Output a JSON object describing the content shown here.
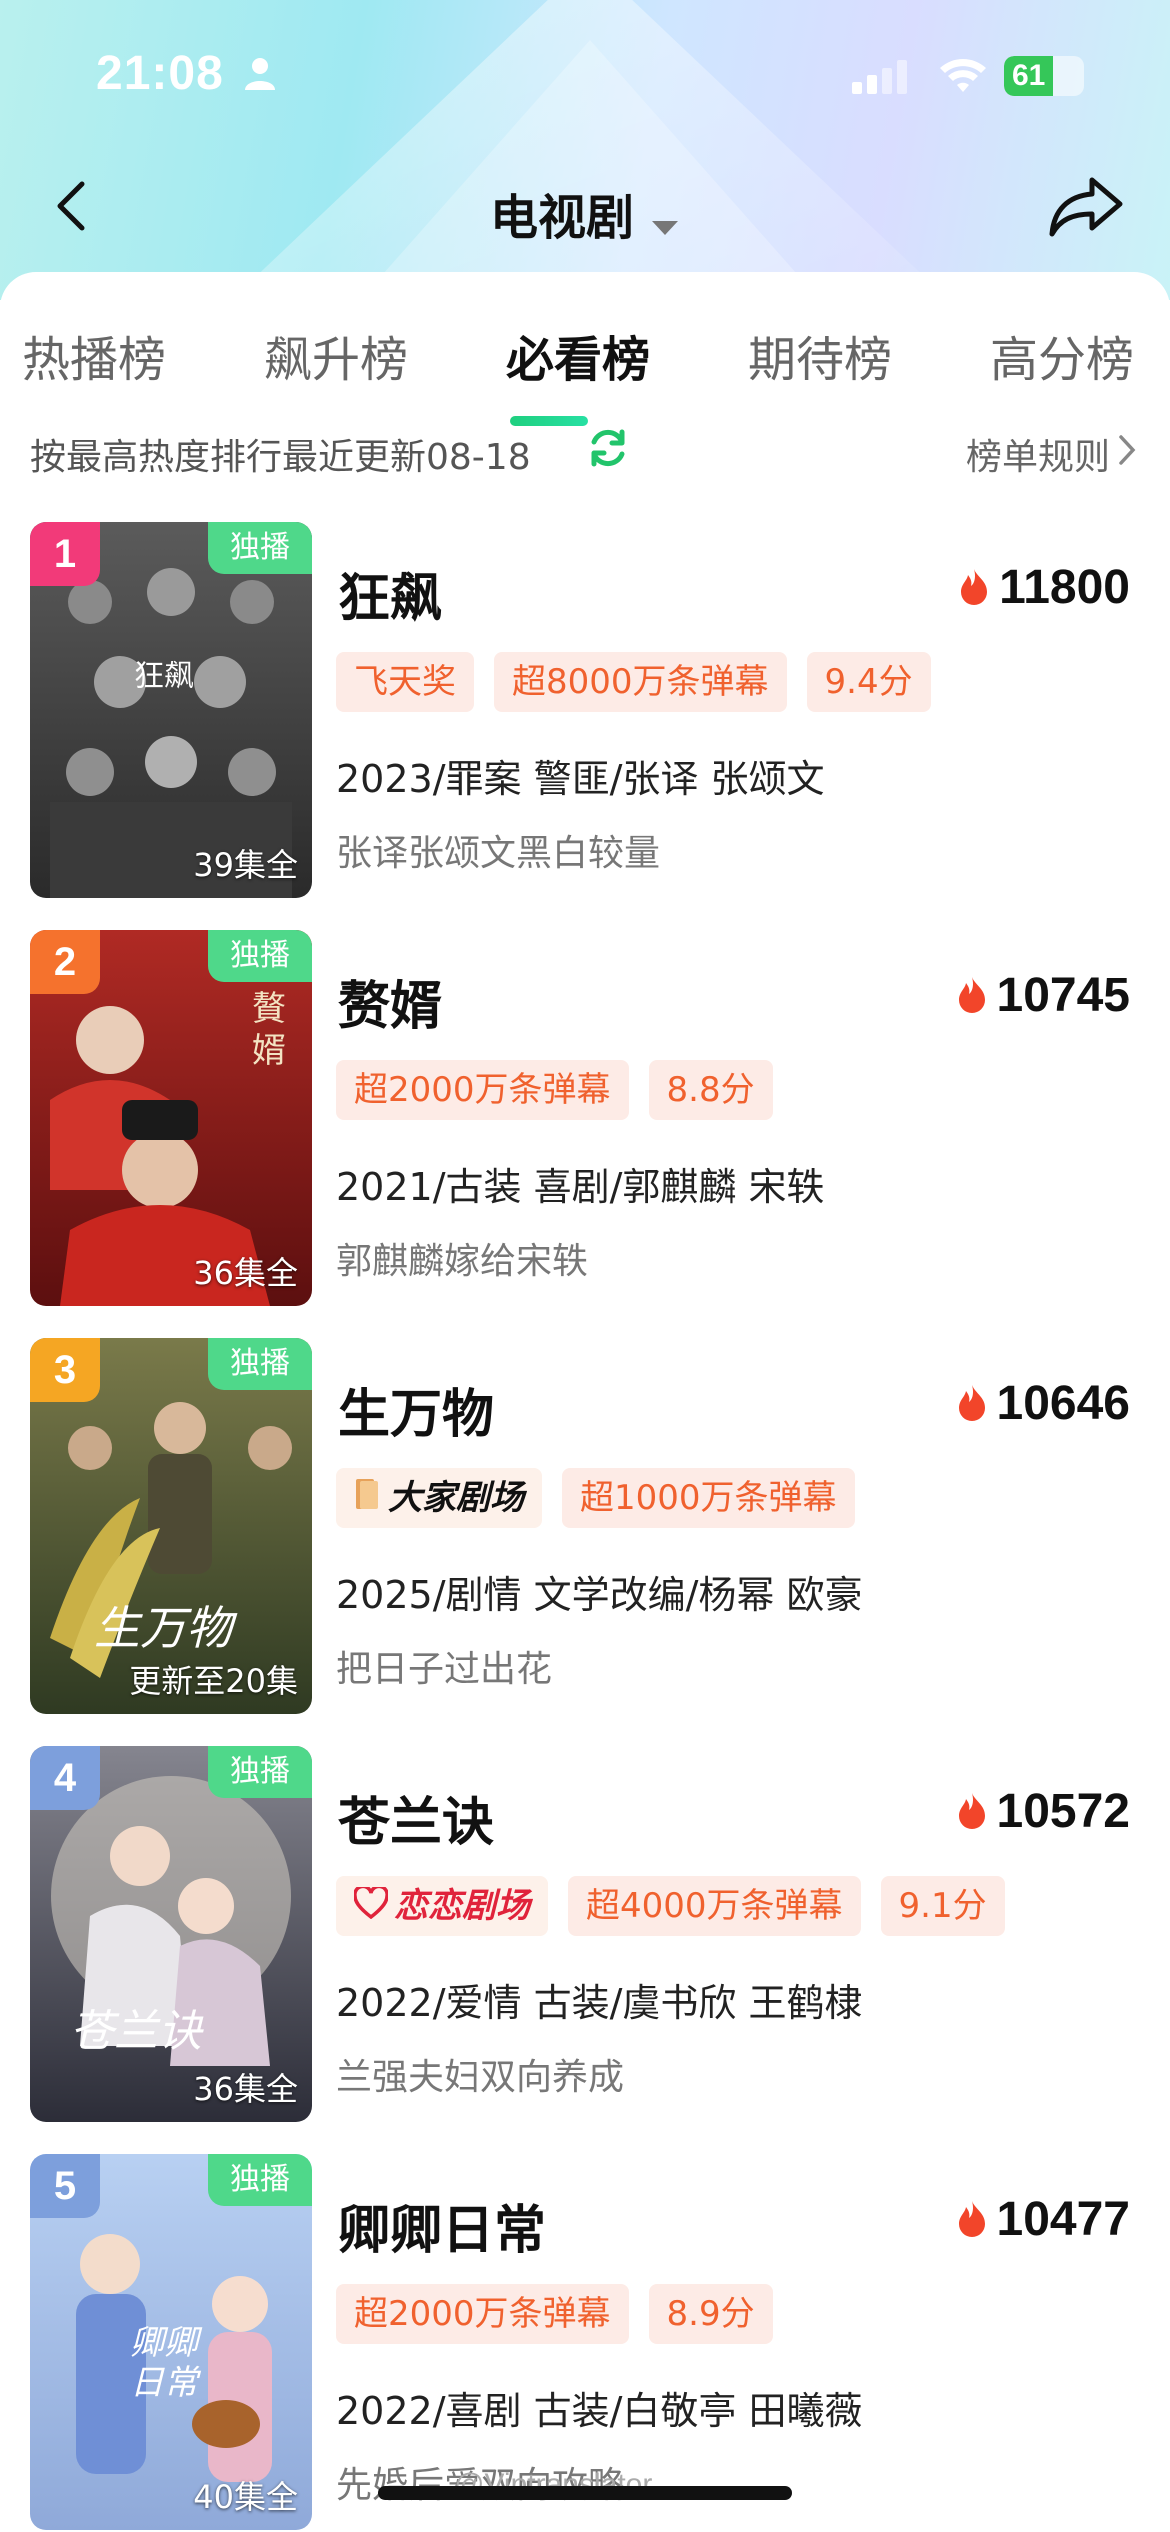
{
  "status_bar": {
    "time": "21:08",
    "battery": "61",
    "battery_level": 0.61
  },
  "nav": {
    "title": "电视剧"
  },
  "tabs": [
    {
      "label": "热播榜"
    },
    {
      "label": "飙升榜"
    },
    {
      "label": "必看榜",
      "active": true
    },
    {
      "label": "期待榜"
    },
    {
      "label": "高分榜"
    }
  ],
  "subbar": {
    "description": "按最高热度排行最近更新08-18",
    "rules_label": "榜单规则"
  },
  "items": [
    {
      "rank": "1",
      "rank_color": "#f23a79",
      "exclusive": "独播",
      "episodes": "39集全",
      "poster_colors": [
        "#4a4a4a",
        "#2a2a2a"
      ],
      "title": "狂飙",
      "heat": "11800",
      "tags": [
        "飞天奖",
        "超8000万条弹幕",
        "9.4分"
      ],
      "meta": "2023/罪案 警匪/张译 张颂文",
      "blurb": "张译张颂文黑白较量"
    },
    {
      "rank": "2",
      "rank_color": "#f5722d",
      "exclusive": "独播",
      "episodes": "36集全",
      "poster_colors": [
        "#a3221f",
        "#5c0f0f"
      ],
      "title": "赘婿",
      "heat": "10745",
      "tags": [
        "超2000万条弹幕",
        "8.8分"
      ],
      "meta": "2021/古装 喜剧/郭麒麟 宋轶",
      "blurb": "郭麒麟嫁给宋轶"
    },
    {
      "rank": "3",
      "rank_color": "#f5a623",
      "exclusive": "独播",
      "episodes": "更新至20集",
      "poster_colors": [
        "#6b6a3a",
        "#2f3a22"
      ],
      "title": "生万物",
      "heat": "10646",
      "logo_tag": "大家剧场",
      "tags": [
        "超1000万条弹幕"
      ],
      "meta": "2025/剧情 文学改编/杨幂 欧豪",
      "blurb": "把日子过出花"
    },
    {
      "rank": "4",
      "rank_color": "#7d9fdc",
      "exclusive": "独播",
      "episodes": "36集全",
      "poster_colors": [
        "#6e6f7a",
        "#2c2d38"
      ],
      "title": "苍兰诀",
      "heat": "10572",
      "logo_tag": "恋恋剧场",
      "tags": [
        "超4000万条弹幕",
        "9.1分"
      ],
      "meta": "2022/爱情 古装/虞书欣 王鹤棣",
      "blurb": "兰强夫妇双向养成"
    },
    {
      "rank": "5",
      "rank_color": "#7d9fdc",
      "exclusive": "独播",
      "episodes": "40集全",
      "poster_colors": [
        "#a9c4ec",
        "#8fa9d9"
      ],
      "title": "卿卿日常",
      "heat": "10477",
      "tags": [
        "超2000万条弹幕",
        "8.9分"
      ],
      "meta": "2022/喜剧 古装/白敬亭 田曦薇",
      "blurb": "先婚后爱双向攻略"
    }
  ],
  "watermark": "@Viptranslator"
}
